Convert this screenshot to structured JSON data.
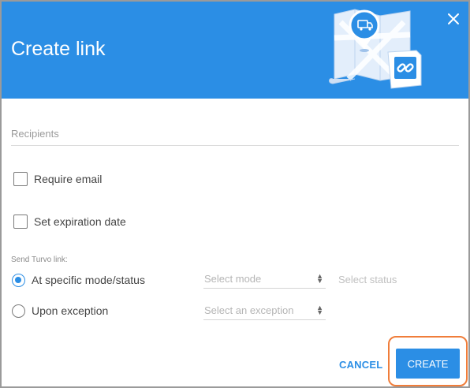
{
  "header": {
    "title": "Create link",
    "bg_color": "#2b8ee5",
    "illustration": "map-with-link-icon",
    "close_icon": "close-icon"
  },
  "form": {
    "recipients_placeholder": "Recipients",
    "require_email_label": "Require email",
    "require_email_checked": false,
    "expiration_label": "Set expiration date",
    "expiration_checked": false,
    "send_link_label": "Send Turvo link:",
    "options": [
      {
        "label": "At specific mode/status",
        "selected": true,
        "select_placeholder": "Select mode",
        "extra_placeholder": "Select status"
      },
      {
        "label": "Upon exception",
        "selected": false,
        "select_placeholder": "Select an exception"
      }
    ]
  },
  "footer": {
    "cancel_label": "CANCEL",
    "create_label": "CREATE",
    "highlight_color": "#f07d3a"
  }
}
